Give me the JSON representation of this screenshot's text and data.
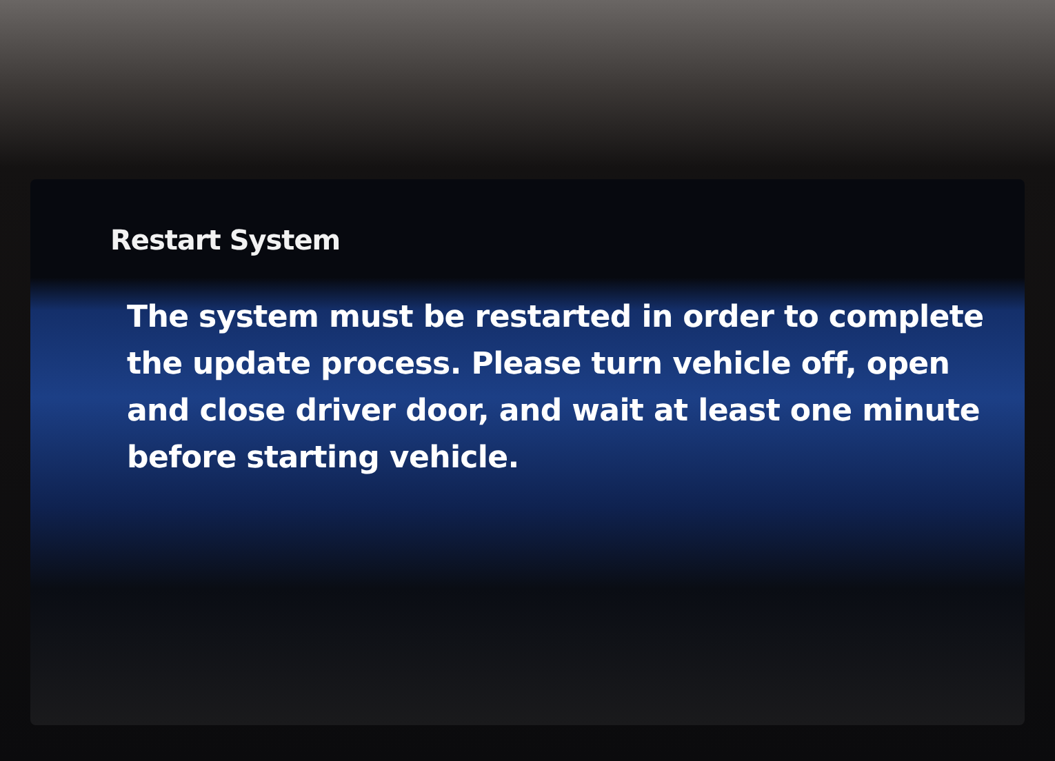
{
  "dialog": {
    "title": "Restart System",
    "message": "The system must be restarted in order to complete the update process. Please turn vehicle off, open and close driver door, and wait at least one minute before starting vehicle."
  }
}
